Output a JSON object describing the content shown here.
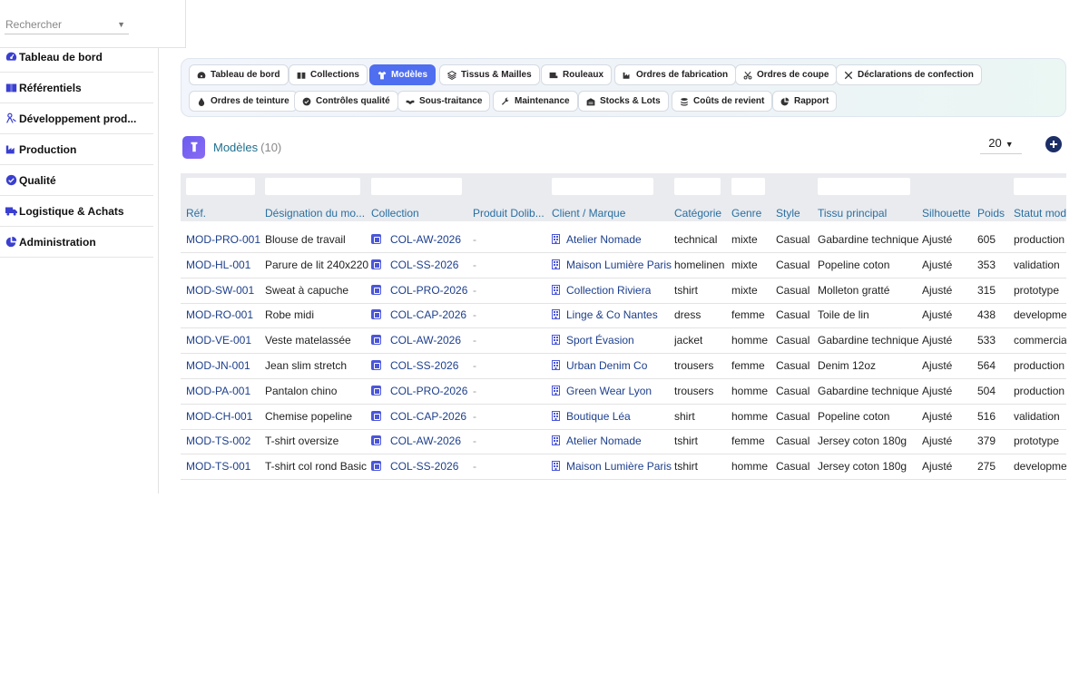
{
  "search": {
    "placeholder": "Rechercher"
  },
  "sidebar": {
    "items": [
      {
        "label": "Tableau de bord",
        "icon": "gauge-icon"
      },
      {
        "label": "Référentiels",
        "icon": "book-icon"
      },
      {
        "label": "Développement prod...",
        "icon": "people-icon"
      },
      {
        "label": "Production",
        "icon": "factory-icon"
      },
      {
        "label": "Qualité",
        "icon": "check-circle-icon"
      },
      {
        "label": "Logistique & Achats",
        "icon": "truck-icon"
      },
      {
        "label": "Administration",
        "icon": "pie-chart-icon"
      }
    ]
  },
  "tabs": [
    {
      "label": "Tableau de bord",
      "icon": "gauge-icon"
    },
    {
      "label": "Collections",
      "icon": "book-icon"
    },
    {
      "label": "Modèles",
      "icon": "shirt-icon",
      "active": true
    },
    {
      "label": "Tissus & Mailles",
      "icon": "layers-icon"
    },
    {
      "label": "Rouleaux",
      "icon": "roll-icon"
    },
    {
      "label": "Ordres de fabrication",
      "icon": "factory-icon"
    },
    {
      "label": "Ordres de coupe",
      "icon": "scissors-icon"
    },
    {
      "label": "Déclarations de confection",
      "icon": "tools-icon"
    },
    {
      "label": "Ordres de teinture",
      "icon": "drop-icon"
    },
    {
      "label": "Contrôles qualité",
      "icon": "check-circle-icon"
    },
    {
      "label": "Sous-traitance",
      "icon": "handshake-icon"
    },
    {
      "label": "Maintenance",
      "icon": "wrench-icon"
    },
    {
      "label": "Stocks & Lots",
      "icon": "warehouse-icon"
    },
    {
      "label": "Coûts de revient",
      "icon": "coins-icon"
    },
    {
      "label": "Rapport",
      "icon": "pie-chart-icon"
    }
  ],
  "list": {
    "title": "Modèles",
    "count": "(10)",
    "per_page": "20"
  },
  "colors": {
    "accent": "#4f6ef0",
    "link": "#1d3f8c",
    "header": "#2a6fa0",
    "title": "#1f6f8e"
  },
  "table": {
    "columns": [
      "Réf.",
      "Désignation du mo...",
      "Collection",
      "Produit Dolib...",
      "Client / Marque",
      "Catégorie",
      "Genre",
      "Style",
      "Tissu principal",
      "Silhouette",
      "Poids",
      "Statut modè"
    ],
    "rows": [
      [
        "MOD-PRO-001",
        "Blouse de travail",
        "COL-AW-2026",
        "-",
        "Atelier Nomade",
        "technical",
        "mixte",
        "Casual",
        "Gabardine technique",
        "Ajusté",
        "605",
        "production"
      ],
      [
        "MOD-HL-001",
        "Parure de lit 240x220",
        "COL-SS-2026",
        "-",
        "Maison Lumière Paris",
        "homelinen",
        "mixte",
        "Casual",
        "Popeline coton",
        "Ajusté",
        "353",
        "validation"
      ],
      [
        "MOD-SW-001",
        "Sweat à capuche",
        "COL-PRO-2026",
        "-",
        "Collection Riviera",
        "tshirt",
        "mixte",
        "Casual",
        "Molleton gratté",
        "Ajusté",
        "315",
        "prototype"
      ],
      [
        "MOD-RO-001",
        "Robe midi",
        "COL-CAP-2026",
        "-",
        "Linge & Co Nantes",
        "dress",
        "femme",
        "Casual",
        "Toile de lin",
        "Ajusté",
        "438",
        "developmen"
      ],
      [
        "MOD-VE-001",
        "Veste matelassée",
        "COL-AW-2026",
        "-",
        "Sport Évasion",
        "jacket",
        "homme",
        "Casual",
        "Gabardine technique",
        "Ajusté",
        "533",
        "commerciali"
      ],
      [
        "MOD-JN-001",
        "Jean slim stretch",
        "COL-SS-2026",
        "-",
        "Urban Denim Co",
        "trousers",
        "femme",
        "Casual",
        "Denim 12oz",
        "Ajusté",
        "564",
        "production"
      ],
      [
        "MOD-PA-001",
        "Pantalon chino",
        "COL-PRO-2026",
        "-",
        "Green Wear Lyon",
        "trousers",
        "homme",
        "Casual",
        "Gabardine technique",
        "Ajusté",
        "504",
        "production"
      ],
      [
        "MOD-CH-001",
        "Chemise popeline",
        "COL-CAP-2026",
        "-",
        "Boutique Léa",
        "shirt",
        "homme",
        "Casual",
        "Popeline coton",
        "Ajusté",
        "516",
        "validation"
      ],
      [
        "MOD-TS-002",
        "T-shirt oversize",
        "COL-AW-2026",
        "-",
        "Atelier Nomade",
        "tshirt",
        "femme",
        "Casual",
        "Jersey coton 180g",
        "Ajusté",
        "379",
        "prototype"
      ],
      [
        "MOD-TS-001",
        "T-shirt col rond Basic",
        "COL-SS-2026",
        "-",
        "Maison Lumière Paris",
        "tshirt",
        "homme",
        "Casual",
        "Jersey coton 180g",
        "Ajusté",
        "275",
        "developmen"
      ]
    ]
  }
}
